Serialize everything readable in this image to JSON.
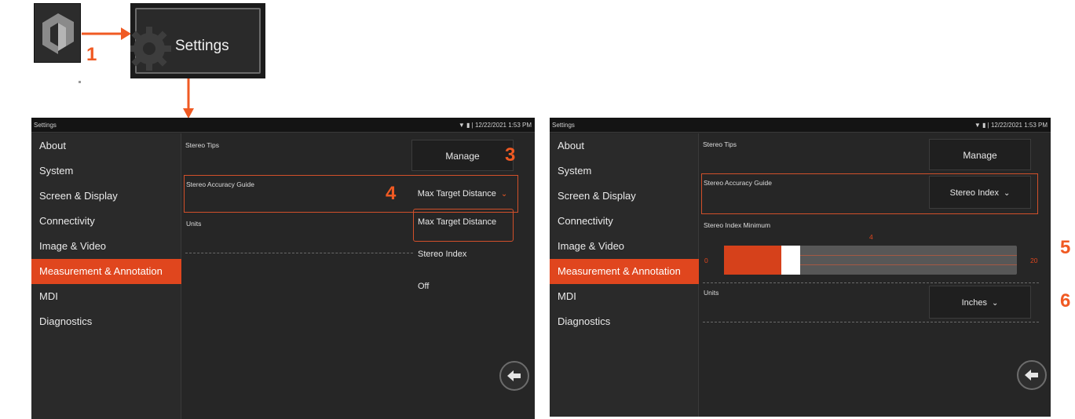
{
  "callouts": {
    "step1": "1",
    "step3": "3",
    "step4": "4",
    "step5": "5",
    "step6": "6"
  },
  "tile": {
    "settings_label": "Settings"
  },
  "icons": {
    "app": "app-logo-icon",
    "gear": "gear-icon",
    "back": "back-arrow-icon",
    "wifi": "wifi-icon",
    "battery": "battery-icon",
    "chevron": "chevron-down-icon"
  },
  "colors": {
    "accent": "#e0461e",
    "arrow": "#f05a23"
  },
  "screen_left": {
    "status": {
      "title": "Settings",
      "datetime": "12/22/2021 1:53 PM"
    },
    "nav": [
      {
        "label": "About",
        "active": false
      },
      {
        "label": "System",
        "active": false
      },
      {
        "label": "Screen & Display",
        "active": false
      },
      {
        "label": "Connectivity",
        "active": false
      },
      {
        "label": "Image & Video",
        "active": false
      },
      {
        "label": "Measurement & Annotation",
        "active": true
      },
      {
        "label": "MDI",
        "active": false
      },
      {
        "label": "Diagnostics",
        "active": false
      }
    ],
    "stereo_tips_label": "Stereo Tips",
    "manage_label": "Manage",
    "accuracy_label": "Stereo Accuracy Guide",
    "accuracy_value": "Max Target Distance",
    "units_label": "Units",
    "dropdown_options": [
      "Max Target Distance",
      "Stereo Index",
      "Off"
    ]
  },
  "screen_right": {
    "status": {
      "title": "Settings",
      "datetime": "12/22/2021 1:53 PM"
    },
    "nav": [
      {
        "label": "About",
        "active": false
      },
      {
        "label": "System",
        "active": false
      },
      {
        "label": "Screen & Display",
        "active": false
      },
      {
        "label": "Connectivity",
        "active": false
      },
      {
        "label": "Image & Video",
        "active": false
      },
      {
        "label": "Measurement & Annotation",
        "active": true
      },
      {
        "label": "MDI",
        "active": false
      },
      {
        "label": "Diagnostics",
        "active": false
      }
    ],
    "stereo_tips_label": "Stereo Tips",
    "manage_label": "Manage",
    "accuracy_label": "Stereo Accuracy Guide",
    "accuracy_value": "Stereo Index",
    "index_min_label": "Stereo Index Minimum",
    "slider": {
      "min": "0",
      "max": "20",
      "value": "4",
      "fraction": 0.2
    },
    "units_label": "Units",
    "units_value": "Inches"
  }
}
